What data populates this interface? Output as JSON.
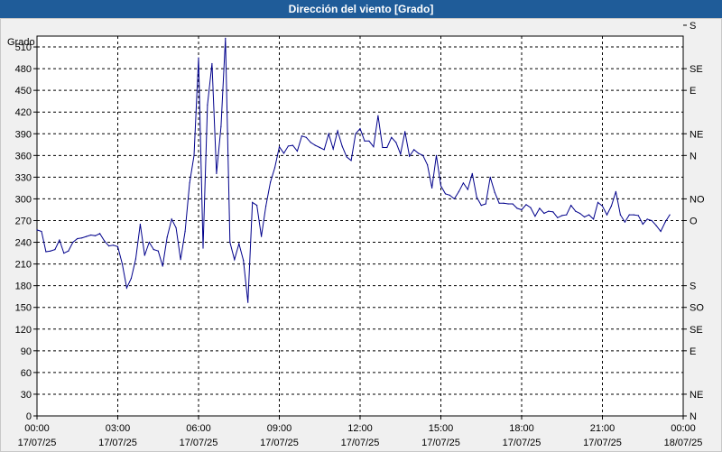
{
  "chart_data": {
    "type": "line",
    "title": "Dirección del viento [Grado]",
    "ylabel": "Grado",
    "ylim": [
      0,
      525
    ],
    "xlim": [
      "17/07/25 00:00",
      "18/07/25 00:00"
    ],
    "y_ticks": [
      0,
      30,
      60,
      90,
      120,
      150,
      180,
      210,
      240,
      270,
      300,
      330,
      360,
      390,
      420,
      450,
      480,
      510
    ],
    "x_ticks": [
      {
        "time": "00:00",
        "date": "17/07/25"
      },
      {
        "time": "03:00",
        "date": "17/07/25"
      },
      {
        "time": "06:00",
        "date": "17/07/25"
      },
      {
        "time": "09:00",
        "date": "17/07/25"
      },
      {
        "time": "12:00",
        "date": "17/07/25"
      },
      {
        "time": "15:00",
        "date": "17/07/25"
      },
      {
        "time": "18:00",
        "date": "17/07/25"
      },
      {
        "time": "21:00",
        "date": "17/07/25"
      },
      {
        "time": "00:00",
        "date": "18/07/25"
      }
    ],
    "right_axis": [
      {
        "label": "N",
        "value": 0
      },
      {
        "label": "NE",
        "value": 30
      },
      {
        "label": "E",
        "value": 90
      },
      {
        "label": "SE",
        "value": 120
      },
      {
        "label": "S",
        "value": 180
      },
      {
        "label": "SO",
        "value": 150
      },
      {
        "label": "O",
        "value": 270
      },
      {
        "label": "NO",
        "value": 300
      },
      {
        "label": "N",
        "value": 360
      },
      {
        "label": "NE",
        "value": 390
      },
      {
        "label": "E",
        "value": 450
      },
      {
        "label": "SE",
        "value": 480
      },
      {
        "label": "S",
        "value": 540
      }
    ],
    "grid": true,
    "line_color": "#00008b",
    "series": [
      {
        "values": [
          [
            "00:00",
            257
          ],
          [
            "00:10",
            255
          ],
          [
            "00:20",
            227
          ],
          [
            "00:30",
            228
          ],
          [
            "00:40",
            230
          ],
          [
            "00:50",
            243
          ],
          [
            "01:00",
            225
          ],
          [
            "01:10",
            228
          ],
          [
            "01:20",
            240
          ],
          [
            "01:30",
            245
          ],
          [
            "01:40",
            246
          ],
          [
            "01:50",
            248
          ],
          [
            "02:00",
            250
          ],
          [
            "02:10",
            249
          ],
          [
            "02:20",
            252
          ],
          [
            "02:30",
            242
          ],
          [
            "02:40",
            235
          ],
          [
            "02:50",
            236
          ],
          [
            "03:00",
            234
          ],
          [
            "03:10",
            210
          ],
          [
            "03:20",
            177
          ],
          [
            "03:30",
            190
          ],
          [
            "03:40",
            217
          ],
          [
            "03:50",
            265
          ],
          [
            "04:00",
            222
          ],
          [
            "04:10",
            240
          ],
          [
            "04:20",
            230
          ],
          [
            "04:30",
            228
          ],
          [
            "04:40",
            207
          ],
          [
            "04:50",
            247
          ],
          [
            "05:00",
            272
          ],
          [
            "05:10",
            260
          ],
          [
            "05:20",
            216
          ],
          [
            "05:30",
            255
          ],
          [
            "05:40",
            322
          ],
          [
            "05:50",
            360
          ],
          [
            "06:00",
            495
          ],
          [
            "06:10",
            232
          ],
          [
            "06:20",
            430
          ],
          [
            "06:30",
            487
          ],
          [
            "06:40",
            335
          ],
          [
            "06:50",
            400
          ],
          [
            "07:00",
            522
          ],
          [
            "07:10",
            240
          ],
          [
            "07:20",
            216
          ],
          [
            "07:30",
            238
          ],
          [
            "07:40",
            215
          ],
          [
            "07:50",
            157
          ],
          [
            "08:00",
            295
          ],
          [
            "08:10",
            291
          ],
          [
            "08:20",
            248
          ],
          [
            "08:30",
            290
          ],
          [
            "08:40",
            323
          ],
          [
            "08:50",
            343
          ],
          [
            "09:00",
            372
          ],
          [
            "09:10",
            363
          ],
          [
            "09:20",
            373
          ],
          [
            "09:30",
            374
          ],
          [
            "09:40",
            366
          ],
          [
            "09:50",
            387
          ],
          [
            "10:00",
            385
          ],
          [
            "10:10",
            378
          ],
          [
            "10:20",
            374
          ],
          [
            "10:30",
            371
          ],
          [
            "10:40",
            368
          ],
          [
            "10:50",
            390
          ],
          [
            "11:00",
            369
          ],
          [
            "11:10",
            394
          ],
          [
            "11:20",
            373
          ],
          [
            "11:30",
            358
          ],
          [
            "11:40",
            353
          ],
          [
            "11:50",
            390
          ],
          [
            "12:00",
            397
          ],
          [
            "12:10",
            380
          ],
          [
            "12:20",
            380
          ],
          [
            "12:30",
            372
          ],
          [
            "12:40",
            415
          ],
          [
            "12:50",
            371
          ],
          [
            "13:00",
            371
          ],
          [
            "13:10",
            385
          ],
          [
            "13:20",
            378
          ],
          [
            "13:30",
            362
          ],
          [
            "13:40",
            393
          ],
          [
            "13:50",
            359
          ],
          [
            "14:00",
            368
          ],
          [
            "14:10",
            363
          ],
          [
            "14:20",
            360
          ],
          [
            "14:30",
            347
          ],
          [
            "14:40",
            315
          ],
          [
            "14:50",
            360
          ],
          [
            "15:00",
            318
          ],
          [
            "15:10",
            307
          ],
          [
            "15:20",
            305
          ],
          [
            "15:30",
            300
          ],
          [
            "15:40",
            310
          ],
          [
            "15:50",
            322
          ],
          [
            "16:00",
            313
          ],
          [
            "16:10",
            335
          ],
          [
            "16:20",
            302
          ],
          [
            "16:30",
            291
          ],
          [
            "16:40",
            293
          ],
          [
            "16:50",
            330
          ],
          [
            "17:00",
            309
          ],
          [
            "17:10",
            294
          ],
          [
            "17:20",
            294
          ],
          [
            "17:30",
            293
          ],
          [
            "17:40",
            293
          ],
          [
            "17:50",
            287
          ],
          [
            "18:00",
            285
          ],
          [
            "18:10",
            292
          ],
          [
            "18:20",
            288
          ],
          [
            "18:30",
            276
          ],
          [
            "18:40",
            287
          ],
          [
            "18:50",
            280
          ],
          [
            "19:00",
            283
          ],
          [
            "19:10",
            282
          ],
          [
            "19:20",
            274
          ],
          [
            "19:30",
            277
          ],
          [
            "19:40",
            278
          ],
          [
            "19:50",
            291
          ],
          [
            "20:00",
            283
          ],
          [
            "20:10",
            280
          ],
          [
            "20:20",
            275
          ],
          [
            "20:30",
            278
          ],
          [
            "20:40",
            272
          ],
          [
            "20:50",
            295
          ],
          [
            "21:00",
            290
          ],
          [
            "21:10",
            278
          ],
          [
            "21:20",
            290
          ],
          [
            "21:30",
            310
          ],
          [
            "21:40",
            278
          ],
          [
            "21:50",
            268
          ],
          [
            "22:00",
            278
          ],
          [
            "22:10",
            278
          ],
          [
            "22:20",
            277
          ],
          [
            "22:30",
            265
          ],
          [
            "22:40",
            272
          ],
          [
            "22:50",
            270
          ],
          [
            "23:00",
            263
          ],
          [
            "23:10",
            255
          ],
          [
            "23:20",
            268
          ],
          [
            "23:30",
            278
          ]
        ]
      }
    ]
  }
}
